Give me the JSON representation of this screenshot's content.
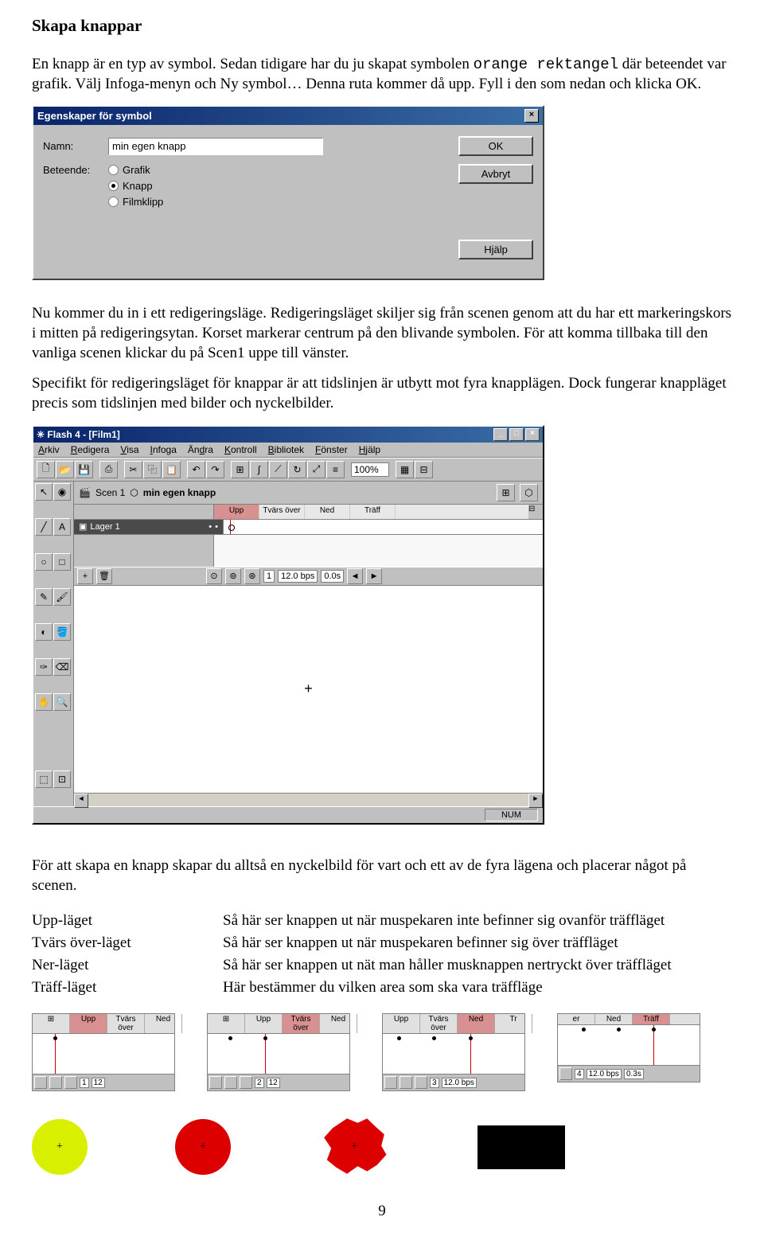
{
  "heading": "Skapa knappar",
  "intro1_a": "En knapp är en typ av symbol. Sedan tidigare har du ju skapat symbolen ",
  "intro1_mono": "orange rektangel",
  "intro1_b": " där beteendet var grafik. Välj Infoga-menyn och Ny symbol… Denna ruta kommer då upp. Fyll i den som nedan och klicka OK.",
  "dialog": {
    "title": "Egenskaper för symbol",
    "labels": {
      "name": "Namn:",
      "behavior": "Beteende:"
    },
    "nameValue": "min egen knapp",
    "radios": {
      "grafik": "Grafik",
      "knapp": "Knapp",
      "filmklipp": "Filmklipp"
    },
    "buttons": {
      "ok": "OK",
      "abort": "Avbryt",
      "help": "Hjälp"
    }
  },
  "para2": "Nu kommer du in i ett redigeringsläge. Redigeringsläget skiljer sig från scenen genom att du har ett markeringskors i mitten på redigeringsytan. Korset markerar centrum på den blivande symbolen. För att komma tillbaka till den vanliga scenen klickar du på Scen1 uppe till vänster.",
  "para3": "Specifikt för redigeringsläget för knappar är att tidslinjen är utbytt mot fyra knapplägen. Dock fungerar knappläget precis som tidslinjen med bilder och nyckelbilder.",
  "app": {
    "title": "Flash 4 - [Film1]",
    "menus": [
      "Arkiv",
      "Redigera",
      "Visa",
      "Infoga",
      "Ändra",
      "Kontroll",
      "Bibliotek",
      "Fönster",
      "Hjälp"
    ],
    "zoom": "100%",
    "scene": "Scen 1",
    "symbol": "min egen knapp",
    "frames": [
      "Upp",
      "Tvärs över",
      "Ned",
      "Träff"
    ],
    "layer": "Lager 1",
    "stageMark": "+",
    "tlFrame": "1",
    "tlFps": "12.0 bps",
    "tlTime": "0.0s",
    "status": "NUM"
  },
  "para4": "För att skapa en knapp skapar du alltså en nyckelbild för vart och ett av de fyra lägena och placerar något på scenen.",
  "defs": {
    "upp": {
      "k": "Upp-läget",
      "v": "Så här ser knappen ut när muspekaren inte befinner sig ovanför träffläget"
    },
    "over": {
      "k": "Tvärs över-läget",
      "v": "Så här ser knappen ut när muspekaren befinner sig över träffläget"
    },
    "ner": {
      "k": "Ner-läget",
      "v": "Så här ser knappen ut nät man håller musknappen nertryckt över träffläget"
    },
    "traff": {
      "k": "Träff-läget",
      "v": "Här bestämmer du vilken area som ska vara träffläge"
    }
  },
  "mini": {
    "heads": [
      [
        "Upp",
        "Tvärs över",
        "Ned"
      ],
      [
        "Upp",
        "Tvärs över",
        "Ned"
      ],
      [
        "Upp",
        "Tvärs över",
        "Ned",
        "Tr"
      ],
      [
        "er",
        "Ned",
        "Träff"
      ]
    ],
    "foot": [
      {
        "n": "1",
        "f": "12"
      },
      {
        "n": "2",
        "f": "12"
      },
      {
        "n": "3",
        "f": "12.0 bps"
      },
      {
        "n": "4",
        "f": "12.0 bps",
        "t": "0.3s"
      }
    ]
  },
  "shapes": {
    "plus1": "+",
    "plus2": "+",
    "plus3": "+"
  },
  "pageNum": "9"
}
